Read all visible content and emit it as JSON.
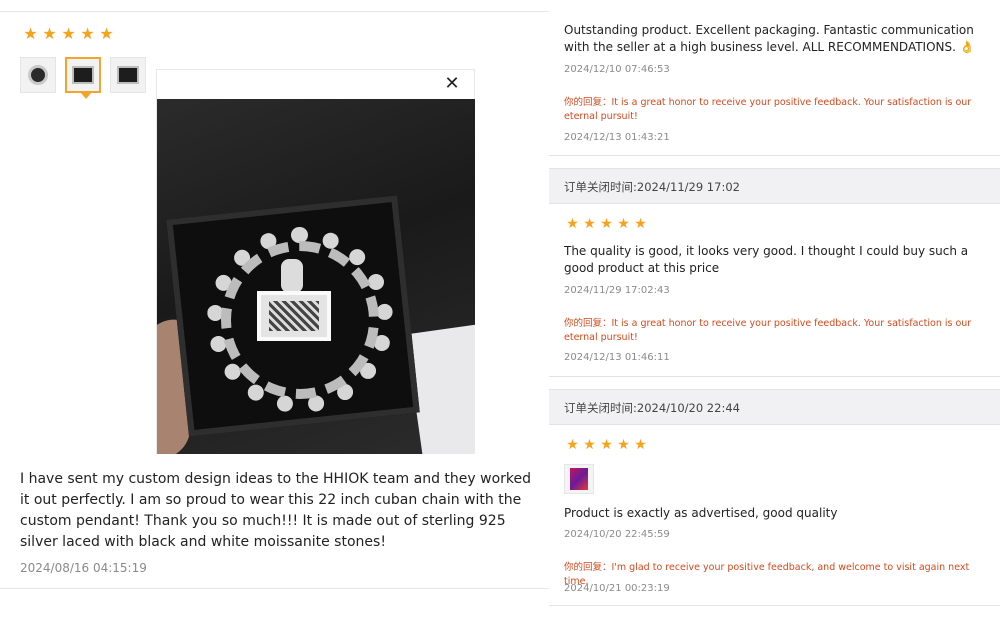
{
  "left_review": {
    "stars": 5,
    "thumbnails": [
      "thumb-1",
      "thumb-2",
      "thumb-3"
    ],
    "selected_thumbnail": 1,
    "close_label": "✕",
    "text": "I have sent my custom design ideas to the HHIOK team and they worked it out perfectly. I am so proud to wear this 22 inch cuban chain with the custom pendant! Thank you so much!!! It is made out of sterling 925 silver laced with black and white moissanite stones!",
    "date": "2024/08/16 04:15:19"
  },
  "right_reviews": [
    {
      "text": "Outstanding product. Excellent packaging. Fantastic communication with the seller at a high business level. ALL RECOMMENDATIONS. 👌",
      "date": "2024/12/10 07:46:53",
      "reply": "你的回复：It is a great honor to receive your positive feedback. Your satisfaction is our eternal pursuit!",
      "reply_date": "2024/12/13 01:43:21"
    },
    {
      "order_bar": "订单关闭时间:2024/11/29 17:02",
      "stars": 5,
      "text": "The quality is good, it looks very good. I thought I could buy such a good product at this price",
      "date": "2024/11/29 17:02:43",
      "reply": "你的回复：It is a great honor to receive your positive feedback. Your satisfaction is our eternal pursuit!",
      "reply_date": "2024/12/13 01:46:11"
    },
    {
      "order_bar": "订单关闭时间:2024/10/20 22:44",
      "stars": 5,
      "text": "Product is exactly as advertised, good quality",
      "date": "2024/10/20 22:45:59",
      "reply": "你的回复：I'm glad to receive your positive feedback, and welcome to visit again next time.",
      "reply_date": "2024/10/21 00:23:19"
    }
  ],
  "colors": {
    "star": "#f7a21b",
    "reply": "#d5491c",
    "selected_border": "#f2a52a"
  }
}
